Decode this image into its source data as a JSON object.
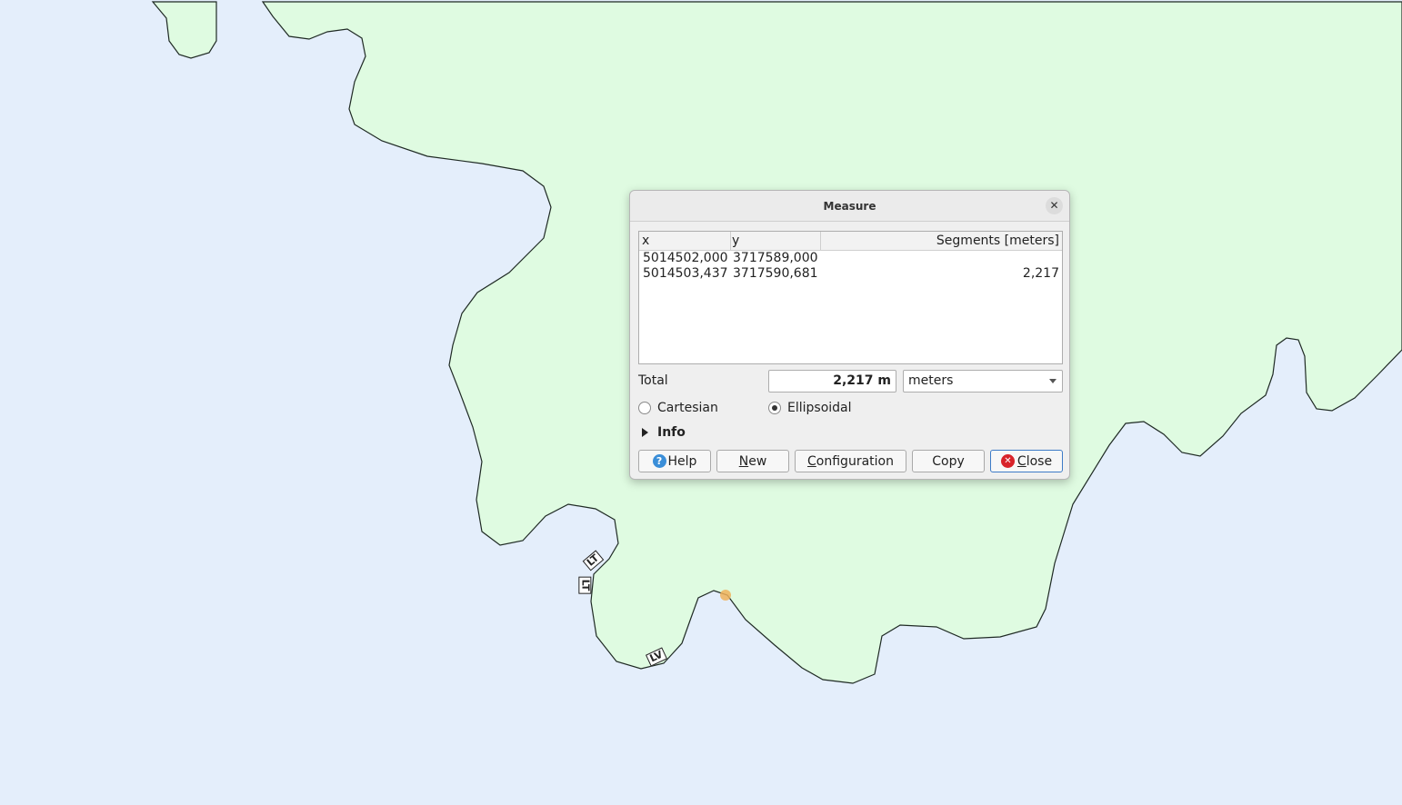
{
  "colors": {
    "water": "#e4eefb",
    "land": "#dffbe1",
    "coastline": "#1f2a24",
    "vertex_marker": "#f0b25a"
  },
  "map": {
    "road_labels": [
      "LT",
      "LT",
      "LV"
    ]
  },
  "dialog": {
    "title": "Measure",
    "table": {
      "headers": [
        "x",
        "y",
        "Segments [meters]"
      ],
      "rows": [
        {
          "x": "5014502,000",
          "y": "3717589,000",
          "segment": ""
        },
        {
          "x": "5014503,437",
          "y": "3717590,681",
          "segment": "2,217"
        }
      ]
    },
    "total_label": "Total",
    "total_value": "2,217 m",
    "units_selected": "meters",
    "radio_cartesian": "Cartesian",
    "radio_ellipsoidal": "Ellipsoidal",
    "radio_selected": "Ellipsoidal",
    "info_label": "Info",
    "buttons": {
      "help": "Help",
      "new_u": "N",
      "new_rest": "ew",
      "config_u": "C",
      "config_rest": "onfiguration",
      "copy": "Copy",
      "close_u": "C",
      "close_rest": "lose"
    },
    "close_icon": "close-icon"
  }
}
